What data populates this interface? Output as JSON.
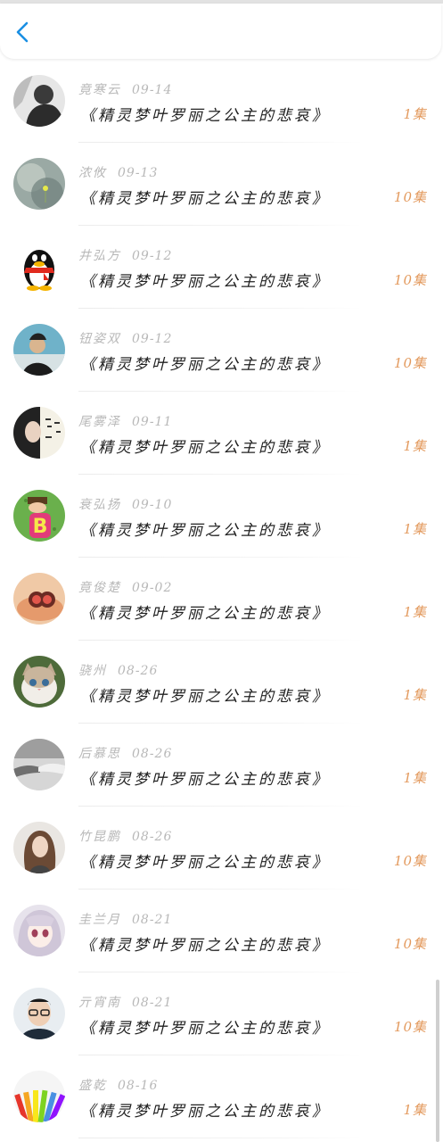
{
  "header": {
    "back_icon": "chevron-left-icon",
    "accent": "#1a8fe3"
  },
  "colors": {
    "name": "#b8b8b8",
    "title": "#222222",
    "count": "#e39a5e"
  },
  "items": [
    {
      "name": "竟寒云",
      "date": "09-14",
      "title": "《精灵梦叶罗丽之公主的悲哀》",
      "count": "1集",
      "avatar": "avatar-bw-portrait"
    },
    {
      "name": "浓攸",
      "date": "09-13",
      "title": "《精灵梦叶罗丽之公主的悲哀》",
      "count": "10集",
      "avatar": "avatar-dandelion"
    },
    {
      "name": "井弘方",
      "date": "09-12",
      "title": "《精灵梦叶罗丽之公主的悲哀》",
      "count": "10集",
      "avatar": "avatar-qq-penguin"
    },
    {
      "name": "钮姿双",
      "date": "09-12",
      "title": "《精灵梦叶罗丽之公主的悲哀》",
      "count": "10集",
      "avatar": "avatar-man-photo"
    },
    {
      "name": "尾雾泽",
      "date": "09-11",
      "title": "《精灵梦叶罗丽之公主的悲哀》",
      "count": "1集",
      "avatar": "avatar-girl-calligraphy"
    },
    {
      "name": "衰弘扬",
      "date": "09-10",
      "title": "《精灵梦叶罗丽之公主的悲哀》",
      "count": "1集",
      "avatar": "avatar-letter-b"
    },
    {
      "name": "竟俊楚",
      "date": "09-02",
      "title": "《精灵梦叶罗丽之公主的悲哀》",
      "count": "1集",
      "avatar": "avatar-cup"
    },
    {
      "name": "骁州",
      "date": "08-26",
      "title": "《精灵梦叶罗丽之公主的悲哀》",
      "count": "1集",
      "avatar": "avatar-kitten"
    },
    {
      "name": "后慕思",
      "date": "08-26",
      "title": "《精灵梦叶罗丽之公主的悲哀》",
      "count": "1集",
      "avatar": "avatar-hands"
    },
    {
      "name": "竹昆鹏",
      "date": "08-26",
      "title": "《精灵梦叶罗丽之公主的悲哀》",
      "count": "10集",
      "avatar": "avatar-woman-hair"
    },
    {
      "name": "圭兰月",
      "date": "08-21",
      "title": "《精灵梦叶罗丽之公主的悲哀》",
      "count": "10集",
      "avatar": "avatar-anime-girl"
    },
    {
      "name": "亓宵南",
      "date": "08-21",
      "title": "《精灵梦叶罗丽之公主的悲哀》",
      "count": "10集",
      "avatar": "avatar-man-glasses"
    },
    {
      "name": "盛乾",
      "date": "08-16",
      "title": "《精灵梦叶罗丽之公主的悲哀》",
      "count": "1集",
      "avatar": "avatar-pencils"
    }
  ]
}
